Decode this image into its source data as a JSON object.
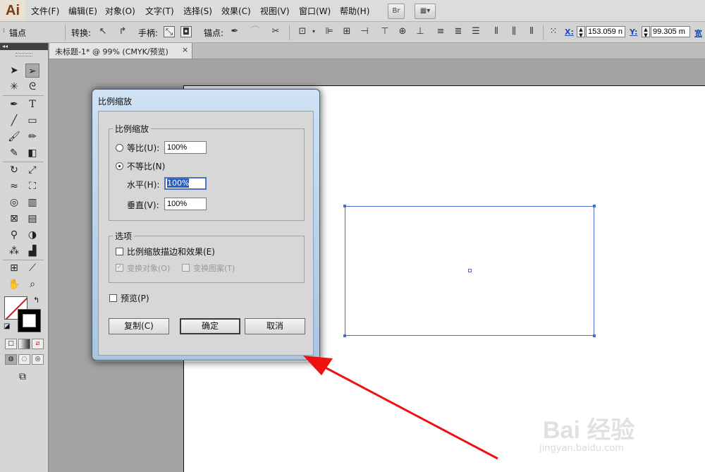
{
  "app": {
    "logo": "Ai"
  },
  "menubar": {
    "items": [
      "文件(F)",
      "编辑(E)",
      "对象(O)",
      "文字(T)",
      "选择(S)",
      "效果(C)",
      "视图(V)",
      "窗口(W)",
      "帮助(H)"
    ],
    "bridge_label": "Br",
    "arrange_icon": "grid-layout-icon"
  },
  "controlbar": {
    "anchor_label": "锚点",
    "convert_label": "转换:",
    "handles_label": "手柄:",
    "anchors_label": "锚点:",
    "x_label": "X:",
    "x_value": "153.059 n",
    "y_label": "Y:",
    "y_value": "99.305 m",
    "w_label": "宽"
  },
  "document": {
    "tab_title": "未标题-1* @ 99% (CMYK/预览)",
    "tab_close": "×"
  },
  "toolpanel": {
    "collapse": "◂◂",
    "swap_icon": "↰",
    "default_icon": "◪"
  },
  "dialog": {
    "title": "比例缩放",
    "scale_group": {
      "label": "比例缩放",
      "uniform_label": "等比(U):",
      "uniform_value": "100%",
      "non_uniform_label": "不等比(N)",
      "horizontal_label": "水平(H):",
      "horizontal_value": "100%",
      "vertical_label": "垂直(V):",
      "vertical_value": "100%",
      "selected": "non_uniform"
    },
    "options_group": {
      "label": "选项",
      "scale_strokes_label": "比例缩放描边和效果(E)",
      "transform_objects_label": "变换对象(O)",
      "transform_patterns_label": "变换图案(T)"
    },
    "preview_label": "预览(P)",
    "copy_button": "复制(C)",
    "ok_button": "确定",
    "cancel_button": "取消"
  },
  "watermark": {
    "text": "Bai 经验",
    "subtext": "jingyan.baidu.com"
  },
  "colors": {
    "selection": "#4a6bd6",
    "arrow": "#ee1111",
    "dialog_frame": "#a9c5e0"
  }
}
